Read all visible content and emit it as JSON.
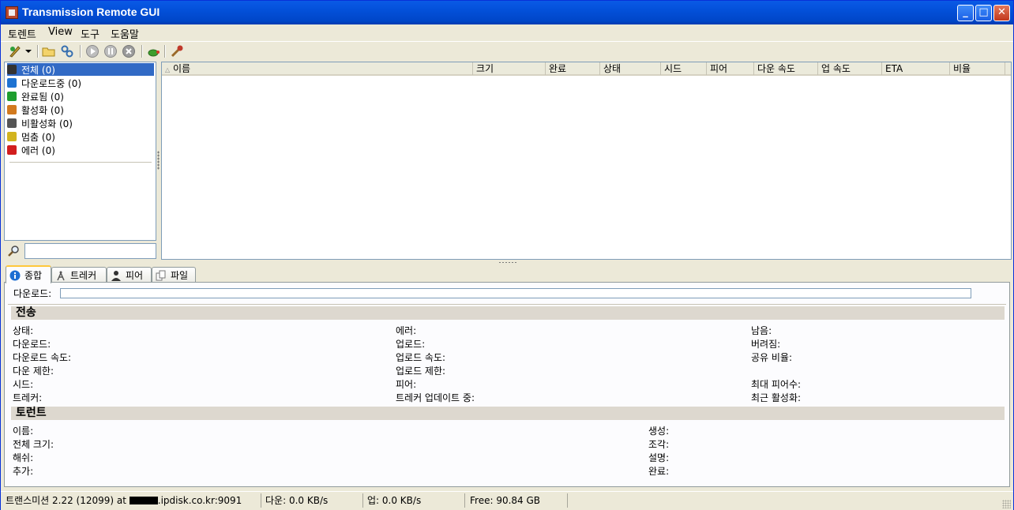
{
  "window": {
    "title": "Transmission Remote GUI"
  },
  "menu": [
    "토렌트",
    "View",
    "도구",
    "도움말"
  ],
  "filters": [
    {
      "label": "전체 (0)",
      "icon": "all-icon",
      "color": "#333333"
    },
    {
      "label": "다운로드중 (0)",
      "icon": "download-icon",
      "color": "#1e73d2"
    },
    {
      "label": "완료됨 (0)",
      "icon": "completed-icon",
      "color": "#1e9e2e"
    },
    {
      "label": "활성화 (0)",
      "icon": "active-icon",
      "color": "#d27a1e"
    },
    {
      "label": "비활성화 (0)",
      "icon": "inactive-icon",
      "color": "#555555"
    },
    {
      "label": "멈춤 (0)",
      "icon": "pause-icon",
      "color": "#d2b41e"
    },
    {
      "label": "에러 (0)",
      "icon": "error-icon",
      "color": "#d21e1e"
    }
  ],
  "columns": [
    "이름",
    "크기",
    "완료",
    "상태",
    "시드",
    "피어",
    "다운 속도",
    "업 속도",
    "ETA",
    "비율"
  ],
  "tabs": [
    "종합",
    "트레커",
    "피어",
    "파일"
  ],
  "general": {
    "download_label": "다운로드:",
    "transfer_title": "전송",
    "transfer": {
      "col1": [
        "상태:",
        "다운로드:",
        "다운로드 속도:",
        "다운 제한:",
        "시드:",
        "트레커:"
      ],
      "col2": [
        "에러:",
        "업로드:",
        "업로드 속도:",
        "업로드 제한:",
        "피어:",
        "트레커 업데이트 중:"
      ],
      "col3": [
        "남음:",
        "버려짐:",
        "공유 비율:",
        "",
        "최대 피어수:",
        "최근 활성화:"
      ]
    },
    "torrent_title": "토런트",
    "torrent": {
      "col1": [
        "이름:",
        "전체 크기:",
        "해쉬:",
        "추가:"
      ],
      "col2": [
        "생성:",
        "조각:",
        "설명:",
        "완료:"
      ]
    }
  },
  "status": {
    "server_prefix": "트랜스미션 2.22 (12099) at ",
    "server_suffix": ".ipdisk.co.kr:9091",
    "down": "다운: 0.0 KB/s",
    "up": "업: 0.0 KB/s",
    "free": "Free: 90.84 GB"
  }
}
